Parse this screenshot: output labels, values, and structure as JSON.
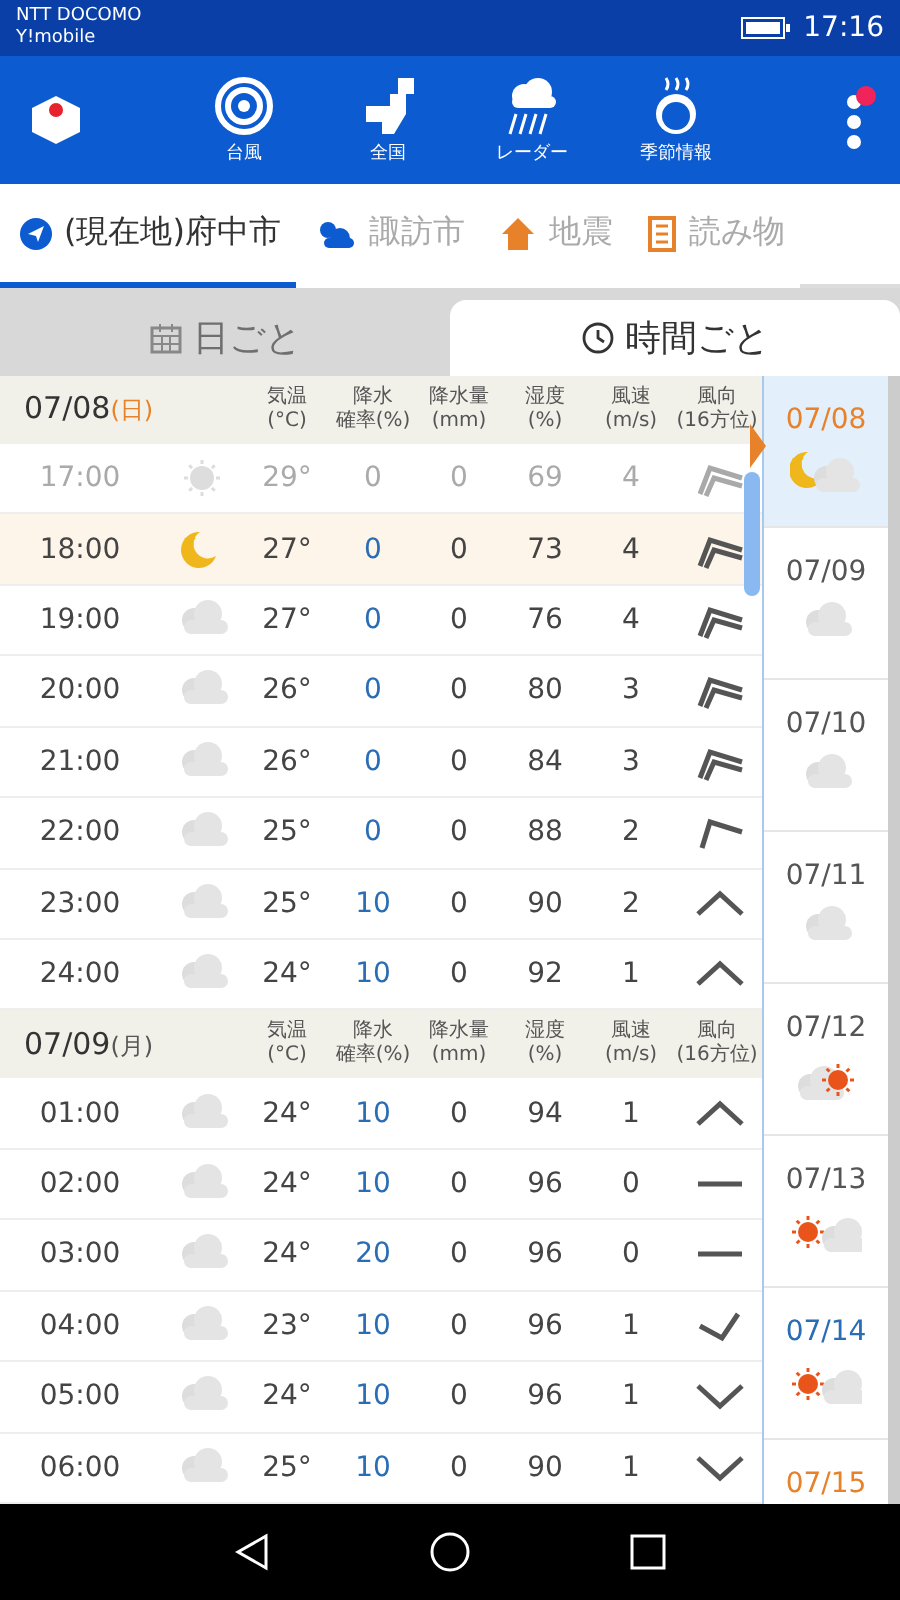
{
  "status_bar": {
    "carrier": "NTT DOCOMO",
    "carrier_2": "Y!mobile",
    "time": "17:16"
  },
  "app_bar": {
    "items": [
      {
        "label": "台風",
        "kind": "typhoon"
      },
      {
        "label": "全国",
        "kind": "map"
      },
      {
        "label": "レーダー",
        "kind": "radar"
      },
      {
        "label": "季節情報",
        "kind": "season"
      }
    ],
    "menu_badge": true
  },
  "tabs": [
    {
      "label": "(現在地)府中市",
      "kind": "location",
      "selected": true
    },
    {
      "label": "諏訪市",
      "kind": "weather",
      "selected": false
    },
    {
      "label": "地震",
      "kind": "quake",
      "selected": false
    },
    {
      "label": "読み物",
      "kind": "reading",
      "selected": false
    }
  ],
  "segments": [
    {
      "label": "日ごと",
      "kind": "calendar",
      "selected": false
    },
    {
      "label": "時間ごと",
      "kind": "clock",
      "selected": true
    }
  ],
  "days": [
    {
      "date": "07/08",
      "weekday": "(日)",
      "color": "#e8822a",
      "columns": [
        {
          "line_1": "気温",
          "line_2": "(°C)"
        },
        {
          "line_1": "降水",
          "line_2": "確率(%)"
        },
        {
          "line_1": "降水量",
          "line_2": "(mm)"
        },
        {
          "line_1": "湿度",
          "line_2": "(%)"
        },
        {
          "line_1": "風速",
          "line_2": "(m/s)"
        },
        {
          "line_1": "風向",
          "line_2": "(16方位)"
        }
      ],
      "rows": [
        {
          "time": "17:00",
          "icon": {
            "kind": "clear"
          },
          "temp": "29°",
          "prob": "0",
          "amount": "0",
          "humidity": "69",
          "speed": "4",
          "wind": {
            "kind": "double"
          },
          "past": true,
          "current": false
        },
        {
          "time": "18:00",
          "icon": {
            "kind": "moon"
          },
          "temp": "27°",
          "prob": "0",
          "amount": "0",
          "humidity": "73",
          "speed": "4",
          "wind": {
            "kind": "double"
          },
          "past": false,
          "current": true
        },
        {
          "time": "19:00",
          "icon": {
            "kind": "cloud"
          },
          "temp": "27°",
          "prob": "0",
          "amount": "0",
          "humidity": "76",
          "speed": "4",
          "wind": {
            "kind": "double"
          },
          "past": false,
          "current": false
        },
        {
          "time": "20:00",
          "icon": {
            "kind": "cloud"
          },
          "temp": "26°",
          "prob": "0",
          "amount": "0",
          "humidity": "80",
          "speed": "3",
          "wind": {
            "kind": "double"
          },
          "past": false,
          "current": false
        },
        {
          "time": "21:00",
          "icon": {
            "kind": "cloud"
          },
          "temp": "26°",
          "prob": "0",
          "amount": "0",
          "humidity": "84",
          "speed": "3",
          "wind": {
            "kind": "double"
          },
          "past": false,
          "current": false
        },
        {
          "time": "22:00",
          "icon": {
            "kind": "cloud"
          },
          "temp": "25°",
          "prob": "0",
          "amount": "0",
          "humidity": "88",
          "speed": "2",
          "wind": {
            "kind": "single"
          },
          "past": false,
          "current": false
        },
        {
          "time": "23:00",
          "icon": {
            "kind": "cloud"
          },
          "temp": "25°",
          "prob": "10",
          "amount": "0",
          "humidity": "90",
          "speed": "2",
          "wind": {
            "kind": "up"
          },
          "past": false,
          "current": false
        },
        {
          "time": "24:00",
          "icon": {
            "kind": "cloud"
          },
          "temp": "24°",
          "prob": "10",
          "amount": "0",
          "humidity": "92",
          "speed": "1",
          "wind": {
            "kind": "up"
          },
          "past": false,
          "current": false
        }
      ]
    },
    {
      "date": "07/09",
      "weekday": "(月)",
      "color": "#555555",
      "columns": [
        {
          "line_1": "気温",
          "line_2": "(°C)"
        },
        {
          "line_1": "降水",
          "line_2": "確率(%)"
        },
        {
          "line_1": "降水量",
          "line_2": "(mm)"
        },
        {
          "line_1": "湿度",
          "line_2": "(%)"
        },
        {
          "line_1": "風速",
          "line_2": "(m/s)"
        },
        {
          "line_1": "風向",
          "line_2": "(16方位)"
        }
      ],
      "rows": [
        {
          "time": "01:00",
          "icon": {
            "kind": "cloud"
          },
          "temp": "24°",
          "prob": "10",
          "amount": "0",
          "humidity": "94",
          "speed": "1",
          "wind": {
            "kind": "up"
          },
          "past": false,
          "current": false
        },
        {
          "time": "02:00",
          "icon": {
            "kind": "cloud"
          },
          "temp": "24°",
          "prob": "10",
          "amount": "0",
          "humidity": "96",
          "speed": "0",
          "wind": {
            "kind": "flat"
          },
          "past": false,
          "current": false
        },
        {
          "time": "03:00",
          "icon": {
            "kind": "cloud"
          },
          "temp": "24°",
          "prob": "20",
          "amount": "0",
          "humidity": "96",
          "speed": "0",
          "wind": {
            "kind": "flat"
          },
          "past": false,
          "current": false
        },
        {
          "time": "04:00",
          "icon": {
            "kind": "cloud"
          },
          "temp": "23°",
          "prob": "10",
          "amount": "0",
          "humidity": "96",
          "speed": "1",
          "wind": {
            "kind": "check"
          },
          "past": false,
          "current": false
        },
        {
          "time": "05:00",
          "icon": {
            "kind": "cloud"
          },
          "temp": "24°",
          "prob": "10",
          "amount": "0",
          "humidity": "96",
          "speed": "1",
          "wind": {
            "kind": "down"
          },
          "past": false,
          "current": false
        },
        {
          "time": "06:00",
          "icon": {
            "kind": "cloud"
          },
          "temp": "25°",
          "prob": "10",
          "amount": "0",
          "humidity": "90",
          "speed": "1",
          "wind": {
            "kind": "down"
          },
          "past": false,
          "current": false
        }
      ]
    }
  ],
  "date_list": [
    {
      "date": "07/08",
      "color": "#e8822a",
      "icon": {
        "kind": "moon-cloud"
      },
      "selected": true
    },
    {
      "date": "07/09",
      "color": "#555555",
      "icon": {
        "kind": "cloud"
      },
      "selected": false
    },
    {
      "date": "07/10",
      "color": "#555555",
      "icon": {
        "kind": "cloud"
      },
      "selected": false
    },
    {
      "date": "07/11",
      "color": "#555555",
      "icon": {
        "kind": "cloud"
      },
      "selected": false
    },
    {
      "date": "07/12",
      "color": "#555555",
      "icon": {
        "kind": "cloud-sun"
      },
      "selected": false
    },
    {
      "date": "07/13",
      "color": "#555555",
      "icon": {
        "kind": "sun-cloud"
      },
      "selected": false
    },
    {
      "date": "07/14",
      "color": "#2a6db5",
      "icon": {
        "kind": "sun-cloud"
      },
      "selected": false
    },
    {
      "date": "07/15",
      "color": "#e8822a",
      "selected": false
    }
  ]
}
